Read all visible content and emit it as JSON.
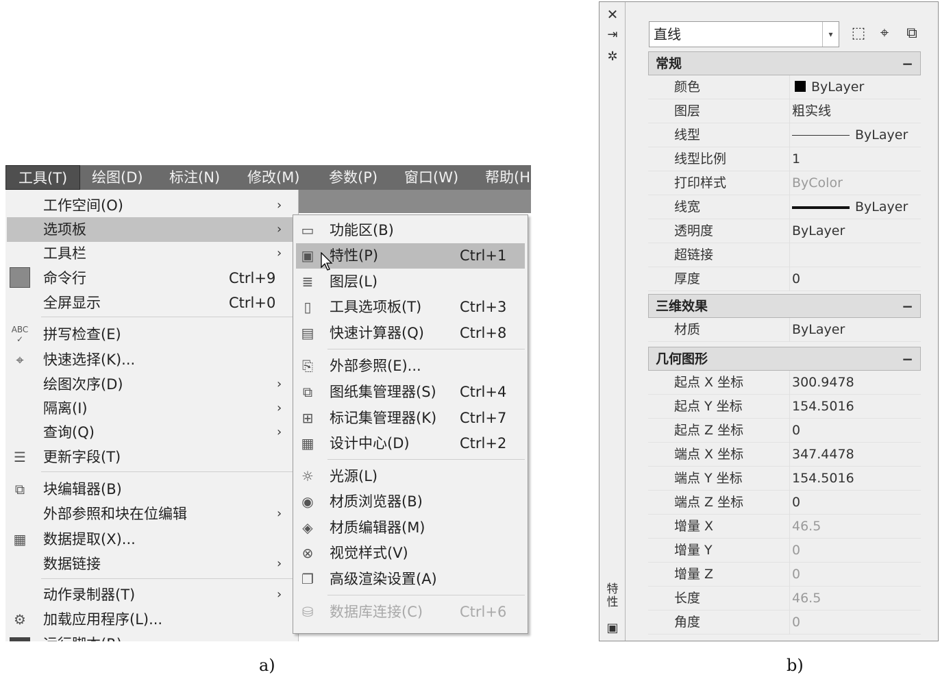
{
  "menubar": {
    "items": [
      "工具(T)",
      "绘图(D)",
      "标注(N)",
      "修改(M)",
      "参数(P)",
      "窗口(W)",
      "帮助(H"
    ]
  },
  "tools_menu": {
    "workspace": "工作空间(O)",
    "palettes": "选项板",
    "toolbars": "工具栏",
    "command_line": "命令行",
    "command_line_sc": "Ctrl+9",
    "clean_screen": "全屏显示",
    "clean_screen_sc": "Ctrl+0",
    "spelling": "拼写检查(E)",
    "quick_select": "快速选择(K)...",
    "draw_order": "绘图次序(D)",
    "isolate": "隔离(I)",
    "inquiry": "查询(Q)",
    "update_fields": "更新字段(T)",
    "block_editor": "块编辑器(B)",
    "xref_edit": "外部参照和块在位编辑",
    "data_extraction": "数据提取(X)...",
    "data_links": "数据链接",
    "action_recorder": "动作录制器(T)",
    "load_app": "加载应用程序(L)...",
    "run_script": "运行脚本(R)..."
  },
  "palettes_menu": {
    "ribbon": "功能区(B)",
    "properties": "特性(P)",
    "properties_sc": "Ctrl+1",
    "layers": "图层(L)",
    "tool_palettes": "工具选项板(T)",
    "tool_palettes_sc": "Ctrl+3",
    "quickcalc": "快速计算器(Q)",
    "quickcalc_sc": "Ctrl+8",
    "xref": "外部参照(E)...",
    "sheet_set": "图纸集管理器(S)",
    "sheet_set_sc": "Ctrl+4",
    "markup": "标记集管理器(K)",
    "markup_sc": "Ctrl+7",
    "design_center": "设计中心(D)",
    "design_center_sc": "Ctrl+2",
    "lights": "光源(L)",
    "materials_browser": "材质浏览器(B)",
    "materials_editor": "材质编辑器(M)",
    "visual_styles": "视觉样式(V)",
    "render_settings": "高级渲染设置(A)",
    "dbconnect": "数据库连接(C)",
    "dbconnect_sc": "Ctrl+6"
  },
  "captions": {
    "a": "a)",
    "b": "b)"
  },
  "properties": {
    "object_type": "直线",
    "side_title": "特性",
    "general": {
      "title": "常规",
      "collapse": "−",
      "rows": [
        {
          "name": "颜色",
          "value": "ByLayer"
        },
        {
          "name": "图层",
          "value": "粗实线"
        },
        {
          "name": "线型",
          "value": "ByLayer"
        },
        {
          "name": "线型比例",
          "value": "1"
        },
        {
          "name": "打印样式",
          "value": "ByColor"
        },
        {
          "name": "线宽",
          "value": "ByLayer"
        },
        {
          "name": "透明度",
          "value": "ByLayer"
        },
        {
          "name": "超链接",
          "value": ""
        },
        {
          "name": "厚度",
          "value": "0"
        }
      ]
    },
    "3d_visualization": {
      "title": "三维效果",
      "collapse": "−",
      "rows": [
        {
          "name": "材质",
          "value": "ByLayer"
        }
      ]
    },
    "geometry": {
      "title": "几何图形",
      "collapse": "−",
      "rows": [
        {
          "name": "起点 X 坐标",
          "value": "300.9478"
        },
        {
          "name": "起点 Y 坐标",
          "value": "154.5016"
        },
        {
          "name": "起点 Z 坐标",
          "value": "0"
        },
        {
          "name": "端点 X 坐标",
          "value": "347.4478"
        },
        {
          "name": "端点 Y 坐标",
          "value": "154.5016"
        },
        {
          "name": "端点 Z 坐标",
          "value": "0"
        },
        {
          "name": "增量 X",
          "value": "46.5"
        },
        {
          "name": "增量 Y",
          "value": "0"
        },
        {
          "name": "增量 Z",
          "value": "0"
        },
        {
          "name": "长度",
          "value": "46.5"
        },
        {
          "name": "角度",
          "value": "0"
        }
      ]
    }
  }
}
